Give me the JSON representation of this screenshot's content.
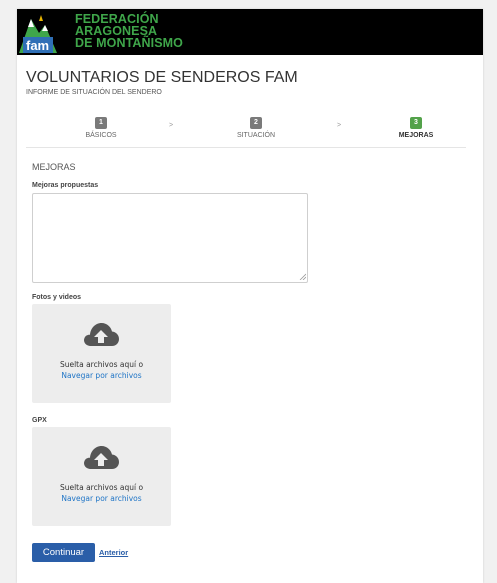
{
  "header": {
    "org_lines": [
      "FEDERACIÓN",
      "ARAGONESA",
      "DE MONTAÑISMO"
    ],
    "logo_text": "fam"
  },
  "page": {
    "title": "VOLUNTARIOS DE SENDEROS FAM",
    "subtitle": "INFORME DE SITUACIÓN DEL SENDERO"
  },
  "steps": [
    {
      "number": "1",
      "label": "BÁSICOS",
      "active": false
    },
    {
      "number": "2",
      "label": "SITUACIÓN",
      "active": false
    },
    {
      "number": "3",
      "label": "MEJORAS",
      "active": true
    }
  ],
  "step_separator": ">",
  "section": {
    "title": "MEJORAS",
    "proposals_label": "Mejoras propuestas",
    "proposals_value": "",
    "photos_label": "Fotos y videos",
    "gpx_label": "GPX"
  },
  "dropzone": {
    "text": "Suelta archivos aquí o",
    "browse_link": "Navegar por archivos"
  },
  "actions": {
    "continue_label": "Continuar",
    "previous_label": "Anterior"
  },
  "colors": {
    "brand_green": "#3fa64a",
    "primary_button": "#2a5ea8",
    "active_step": "#53a24a",
    "link": "#1e74c6"
  }
}
